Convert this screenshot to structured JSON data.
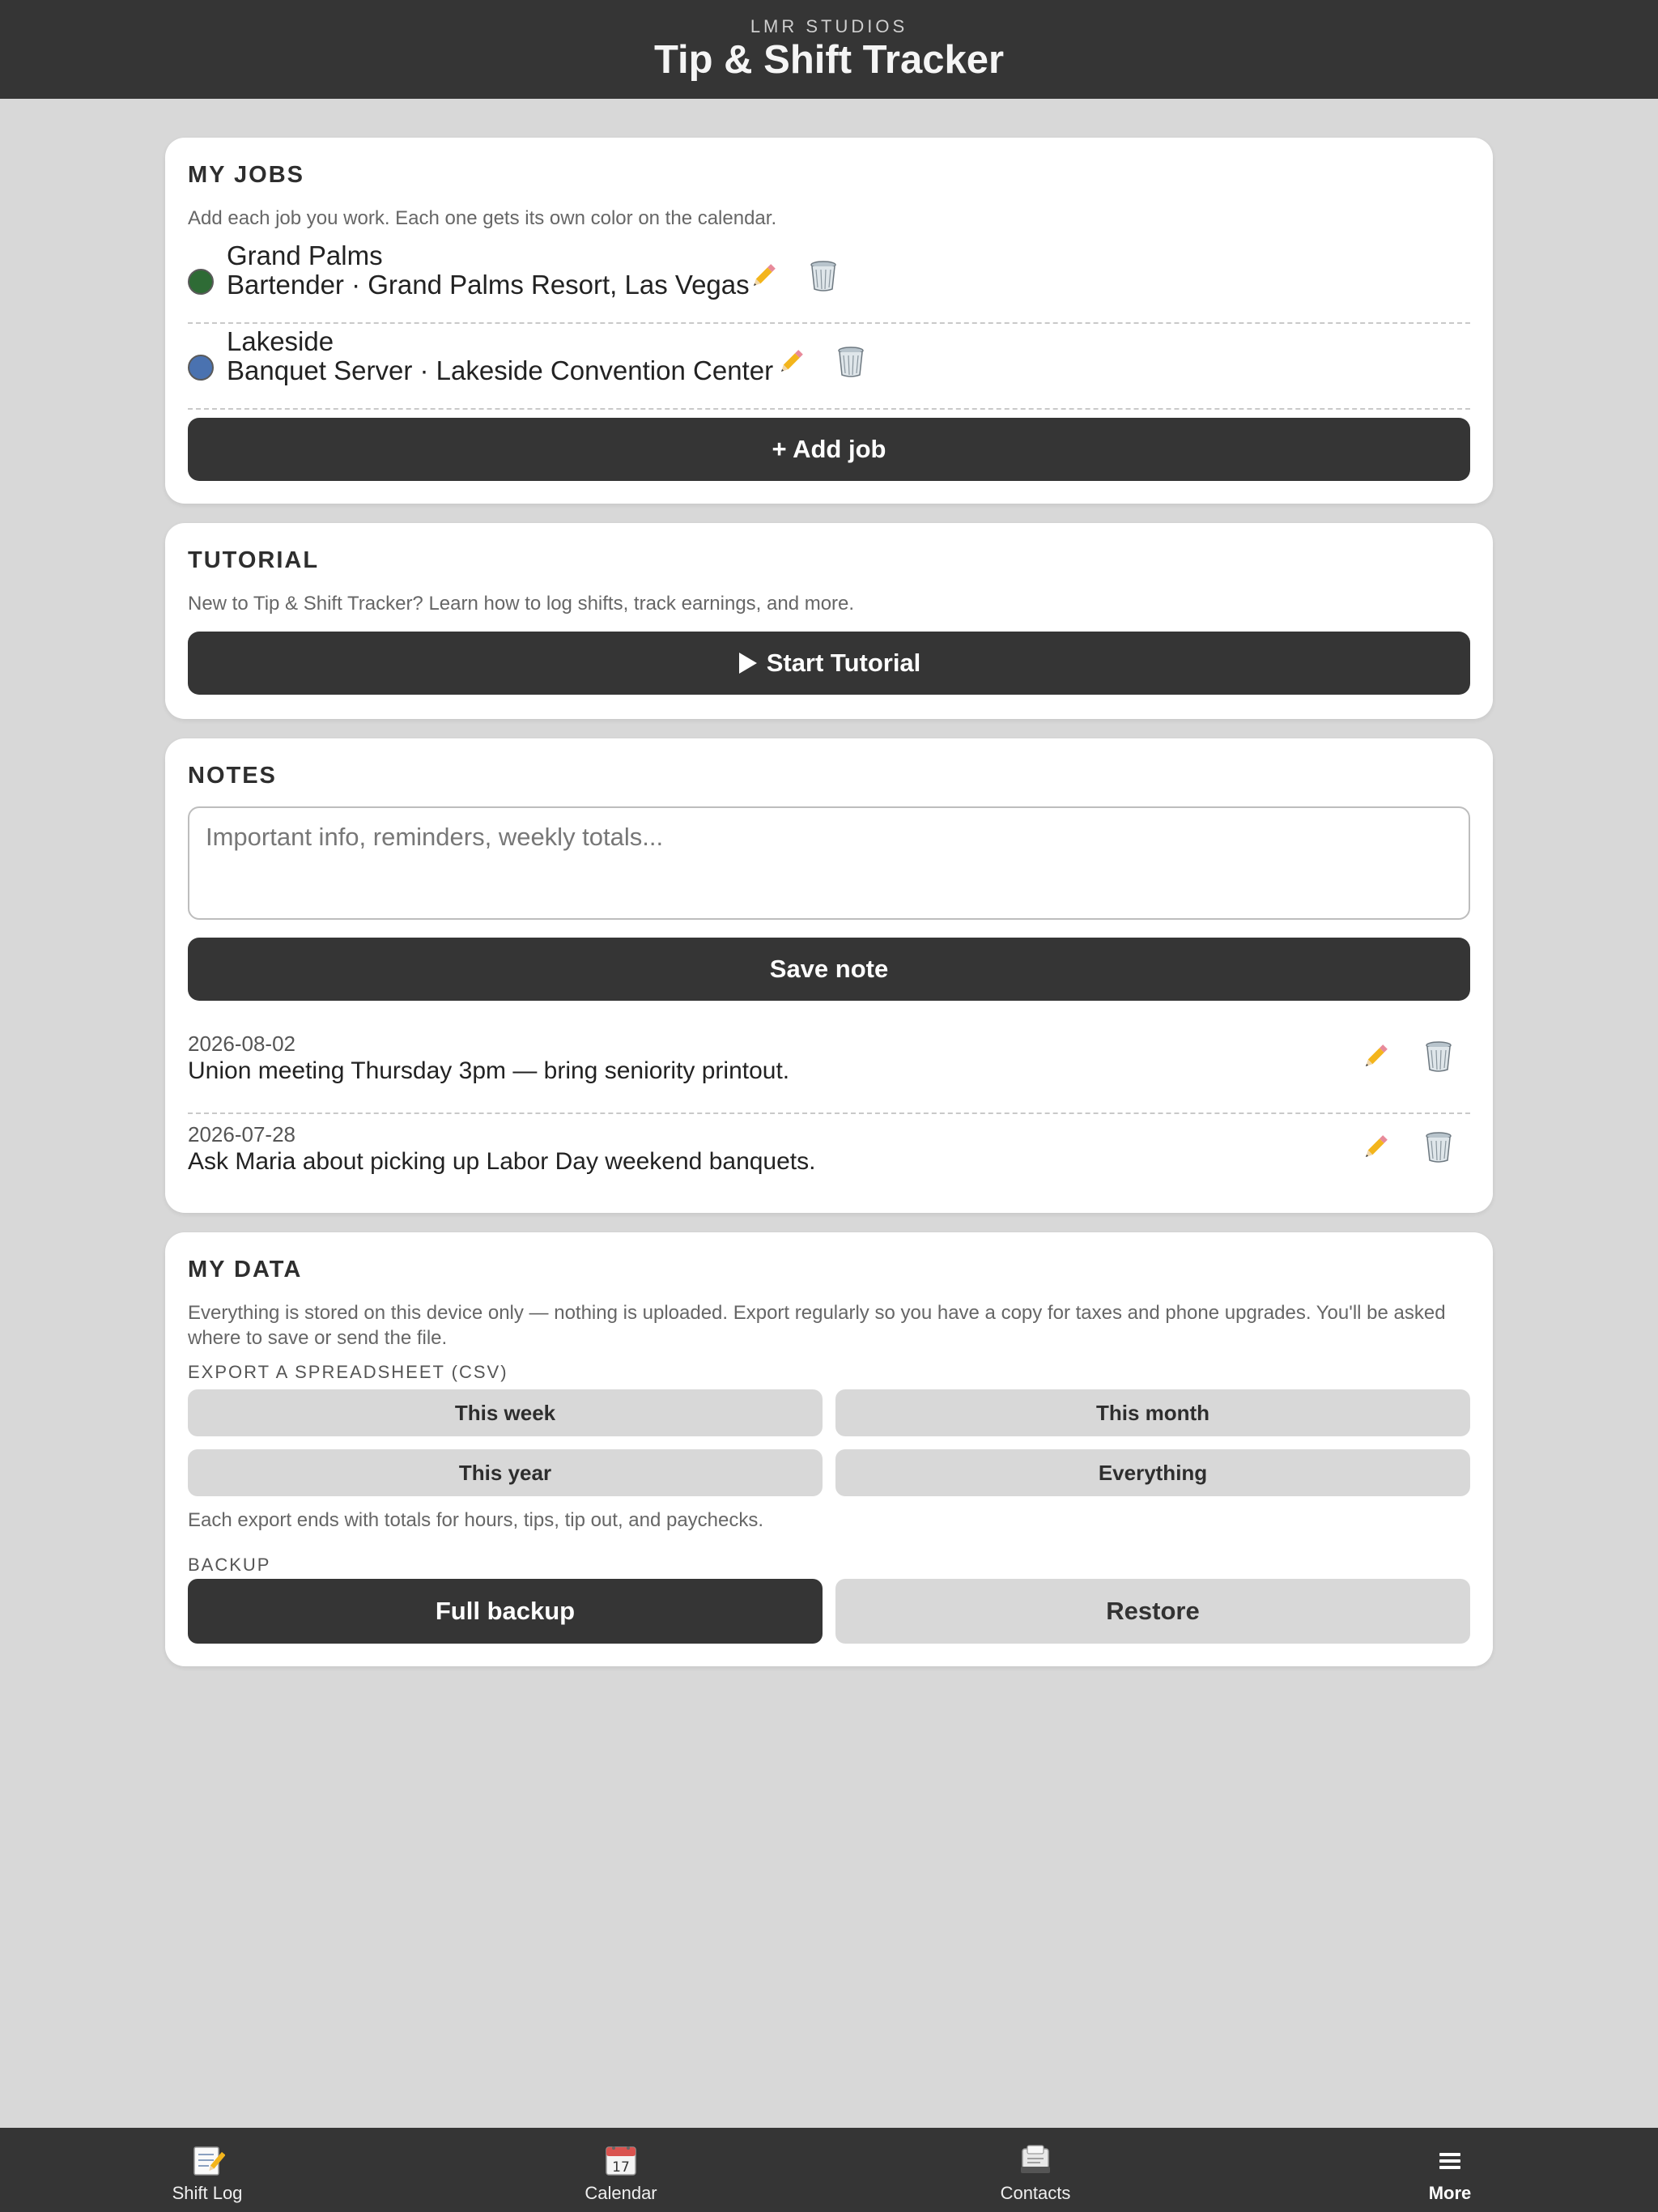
{
  "header": {
    "brand": "LMR STUDIOS",
    "title": "Tip & Shift Tracker"
  },
  "jobs": {
    "heading": "MY JOBS",
    "description": "Add each job you work. Each one gets its own color on the calendar.",
    "items": [
      {
        "name": "Grand Palms",
        "detail": "Bartender · Grand Palms Resort, Las Vegas",
        "color": "#2e6b35"
      },
      {
        "name": "Lakeside",
        "detail": "Banquet Server · Lakeside Convention Center",
        "color": "#4a72b0"
      }
    ],
    "add_label": "+ Add job"
  },
  "tutorial": {
    "heading": "TUTORIAL",
    "description": "New to Tip & Shift Tracker? Learn how to log shifts, track earnings, and more.",
    "button_label": "Start Tutorial"
  },
  "notes": {
    "heading": "NOTES",
    "placeholder": "Important info, reminders, weekly totals...",
    "save_label": "Save note",
    "items": [
      {
        "date": "2026-08-02",
        "text": "Union meeting Thursday 3pm — bring seniority printout."
      },
      {
        "date": "2026-07-28",
        "text": "Ask Maria about picking up Labor Day weekend banquets."
      }
    ]
  },
  "data": {
    "heading": "MY DATA",
    "description": "Everything is stored on this device only — nothing is uploaded. Export regularly so you have a copy for taxes and phone upgrades. You'll be asked where to save or send the file.",
    "export_label": "EXPORT A SPREADSHEET (CSV)",
    "export_buttons": [
      "This week",
      "This month",
      "This year",
      "Everything"
    ],
    "export_note": "Each export ends with totals for hours, tips, tip out, and paychecks.",
    "backup_label": "BACKUP",
    "full_backup_label": "Full backup",
    "restore_label": "Restore"
  },
  "nav": {
    "items": [
      {
        "label": "Shift Log",
        "icon": "memo-icon"
      },
      {
        "label": "Calendar",
        "icon": "calendar-icon"
      },
      {
        "label": "Contacts",
        "icon": "contacts-icon"
      },
      {
        "label": "More",
        "icon": "menu-icon",
        "active": true
      }
    ]
  }
}
